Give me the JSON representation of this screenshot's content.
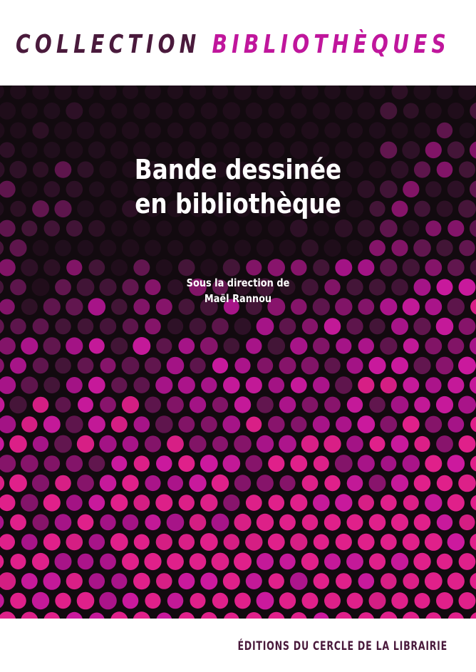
{
  "series": {
    "word1": "COLLECTION",
    "word2": "BIBLIOTHÈQUES"
  },
  "title": {
    "line1": "Bande dessinée",
    "line2": "en bibliothèque"
  },
  "editor": {
    "line1": "Sous la direction de",
    "line2": "Maël Rannou"
  },
  "publisher": "ÉDITIONS DU CERCLE DE LA LIBRAIRIE",
  "colors": {
    "series_dark": "#4a1a3c",
    "series_accent": "#c0169c",
    "background": "#120a0f",
    "dots": [
      "#2a1024",
      "#3d1533",
      "#5a1a4a",
      "#7a1a63",
      "#a0177f",
      "#c0169c",
      "#d81ba8",
      "#e0208a"
    ]
  }
}
